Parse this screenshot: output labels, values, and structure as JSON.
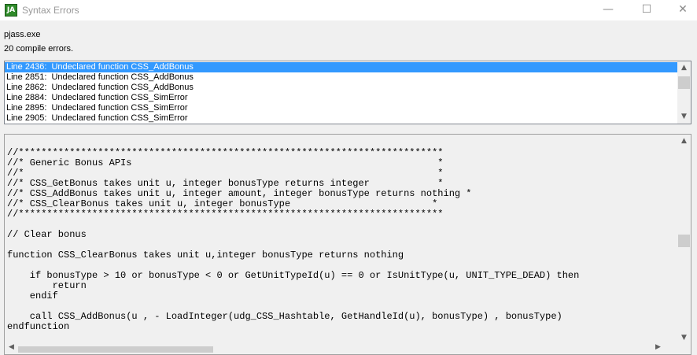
{
  "window": {
    "title": "Syntax Errors",
    "icon_text": "JA",
    "controls": {
      "minimize": "—",
      "maximize": "☐",
      "close": "✕"
    }
  },
  "compiler": {
    "name": "pjass.exe",
    "summary": "20 compile errors."
  },
  "errors": [
    "Line 2436:  Undeclared function CSS_AddBonus",
    "Line 2851:  Undeclared function CSS_AddBonus",
    "Line 2862:  Undeclared function CSS_AddBonus",
    "Line 2884:  Undeclared function CSS_SimError",
    "Line 2895:  Undeclared function CSS_SimError",
    "Line 2905:  Undeclared function CSS_SimError"
  ],
  "selected_error_index": 0,
  "code_lines": [
    "//***************************************************************************",
    "//* Generic Bonus APIs                                                      *",
    "//*                                                                         *",
    "//* CSS_GetBonus takes unit u, integer bonusType returns integer            *",
    "//* CSS_AddBonus takes unit u, integer amount, integer bonusType returns nothing *",
    "//* CSS_ClearBonus takes unit u, integer bonusType                         *",
    "//***************************************************************************",
    "",
    "// Clear bonus",
    "",
    "function CSS_ClearBonus takes unit u,integer bonusType returns nothing",
    "",
    "    if bonusType > 10 or bonusType < 0 or GetUnitTypeId(u) == 0 or IsUnitType(u, UNIT_TYPE_DEAD) then",
    "        return",
    "    endif",
    "",
    "    call CSS_AddBonus(u , - LoadInteger(udg_CSS_Hashtable, GetHandleId(u), bonusType) , bonusType)",
    "endfunction"
  ],
  "scrollbar": {
    "up": "▲",
    "down": "▼",
    "left": "◀",
    "right": "▶"
  }
}
